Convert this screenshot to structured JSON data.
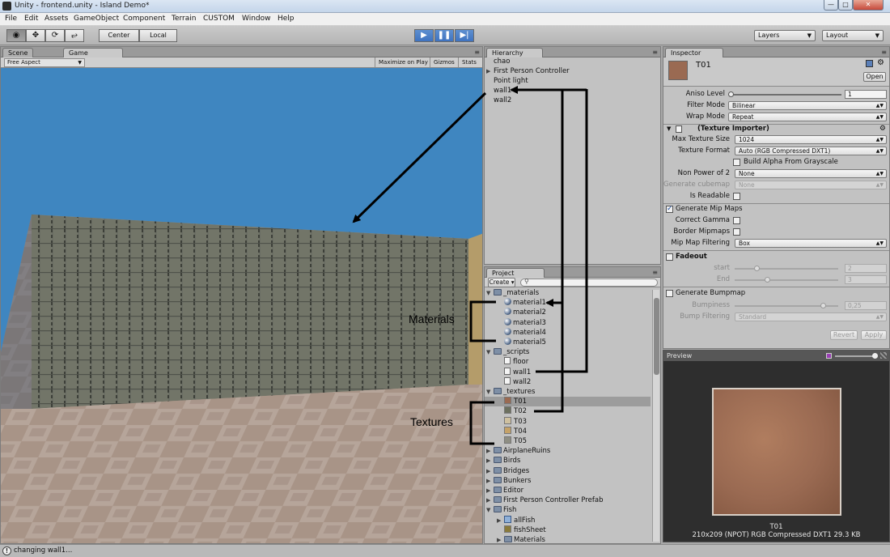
{
  "window": {
    "title": "Unity - frontend.unity - Island Demo*"
  },
  "menu": [
    "File",
    "Edit",
    "Assets",
    "GameObject",
    "Component",
    "Terrain",
    "CUSTOM",
    "Window",
    "Help"
  ],
  "toolbar": {
    "pivot_label": "Center",
    "space_label": "Local",
    "layers_label": "Layers",
    "layout_label": "Layout",
    "play_active": true
  },
  "scene_tab": "Scene",
  "game_tab": "Game",
  "game_bar": {
    "aspect": "Free Aspect",
    "maximize": "Maximize on Play",
    "gizmos": "Gizmos",
    "stats": "Stats"
  },
  "hierarchy": {
    "tab": "Hierarchy",
    "items": [
      {
        "label": "chao",
        "expandable": false
      },
      {
        "label": "First Person Controller",
        "expandable": true
      },
      {
        "label": "Point light",
        "expandable": false
      },
      {
        "label": "wall1",
        "expandable": false
      },
      {
        "label": "wall2",
        "expandable": false
      }
    ]
  },
  "project": {
    "tab": "Project",
    "create_label": "Create",
    "search_placeholder": "",
    "items": [
      {
        "label": "_materials",
        "kind": "folder",
        "depth": 0,
        "open": true
      },
      {
        "label": "material1",
        "kind": "material",
        "depth": 1
      },
      {
        "label": "material2",
        "kind": "material",
        "depth": 1
      },
      {
        "label": "material3",
        "kind": "material",
        "depth": 1
      },
      {
        "label": "material4",
        "kind": "material",
        "depth": 1
      },
      {
        "label": "material5",
        "kind": "material",
        "depth": 1
      },
      {
        "label": "_scripts",
        "kind": "folder",
        "depth": 0,
        "open": true
      },
      {
        "label": "floor",
        "kind": "script",
        "depth": 1
      },
      {
        "label": "wall1",
        "kind": "script",
        "depth": 1
      },
      {
        "label": "wall2",
        "kind": "script",
        "depth": 1
      },
      {
        "label": "_textures",
        "kind": "folder",
        "depth": 0,
        "open": true
      },
      {
        "label": "T01",
        "kind": "texture",
        "depth": 1,
        "color": "#9a6a52",
        "selected": true
      },
      {
        "label": "T02",
        "kind": "texture",
        "depth": 1,
        "color": "#6c705f"
      },
      {
        "label": "T03",
        "kind": "texture",
        "depth": 1,
        "color": "#cfc1a0"
      },
      {
        "label": "T04",
        "kind": "texture",
        "depth": 1,
        "color": "#c5a268"
      },
      {
        "label": "T05",
        "kind": "texture",
        "depth": 1,
        "color": "#8e8e83"
      },
      {
        "label": "AirplaneRuins",
        "kind": "folder",
        "depth": 0,
        "open": false
      },
      {
        "label": "Birds",
        "kind": "folder",
        "depth": 0,
        "open": false
      },
      {
        "label": "Bridges",
        "kind": "folder",
        "depth": 0,
        "open": false
      },
      {
        "label": "Bunkers",
        "kind": "folder",
        "depth": 0,
        "open": false
      },
      {
        "label": "Editor",
        "kind": "folder",
        "depth": 0,
        "open": false
      },
      {
        "label": "First Person Controller Prefab",
        "kind": "folder",
        "depth": 0,
        "open": false
      },
      {
        "label": "Fish",
        "kind": "folder",
        "depth": 0,
        "open": true
      },
      {
        "label": "allFish",
        "kind": "prefab",
        "depth": 1,
        "expandable": true
      },
      {
        "label": "fishSheet",
        "kind": "texture",
        "depth": 1,
        "color": "#8a7a3a"
      },
      {
        "label": "Materials",
        "kind": "folder",
        "depth": 1,
        "open": false
      }
    ]
  },
  "annotations": {
    "materials_label": "Materials",
    "textures_label": "Textures"
  },
  "inspector": {
    "tab": "Inspector",
    "asset_name": "T01",
    "open_label": "Open",
    "aniso_label": "Aniso Level",
    "aniso_value": "1",
    "filter_label": "Filter Mode",
    "filter_value": "Bilinear",
    "wrap_label": "Wrap Mode",
    "wrap_value": "Repeat",
    "importer_title": "(Texture Importer)",
    "max_size_label": "Max Texture Size",
    "max_size_value": "1024",
    "format_label": "Texture Format",
    "format_value": "Auto (RGB Compressed DXT1)",
    "alpha_label": "Build Alpha From Grayscale",
    "npot_label": "Non Power of 2",
    "npot_value": "None",
    "cubemap_label": "Generate cubemap",
    "cubemap_value": "None",
    "readable_label": "Is Readable",
    "mip_label": "Generate Mip Maps",
    "gamma_label": "Correct Gamma",
    "border_mip_label": "Border Mipmaps",
    "mip_filter_label": "Mip Map Filtering",
    "mip_filter_value": "Box",
    "fadeout_label": "Fadeout",
    "start_label": "start",
    "start_value": "2",
    "end_label": "End",
    "end_value": "3",
    "bump_label": "Generate Bumpmap",
    "bumpiness_label": "Bumpiness",
    "bumpiness_value": "0,25",
    "bump_filter_label": "Bump Filtering",
    "bump_filter_value": "Standard",
    "revert_label": "Revert",
    "apply_label": "Apply"
  },
  "preview": {
    "header": "Preview",
    "name": "T01",
    "info": "210x209 (NPOT)  RGB Compressed DXT1  29.3 KB"
  },
  "status": {
    "message": "changing wall1..."
  },
  "colors": {
    "sky": "#3f86c0",
    "wall": "#6b6e64",
    "floor": "#a89487",
    "play_accent": "#4a7fc8"
  }
}
